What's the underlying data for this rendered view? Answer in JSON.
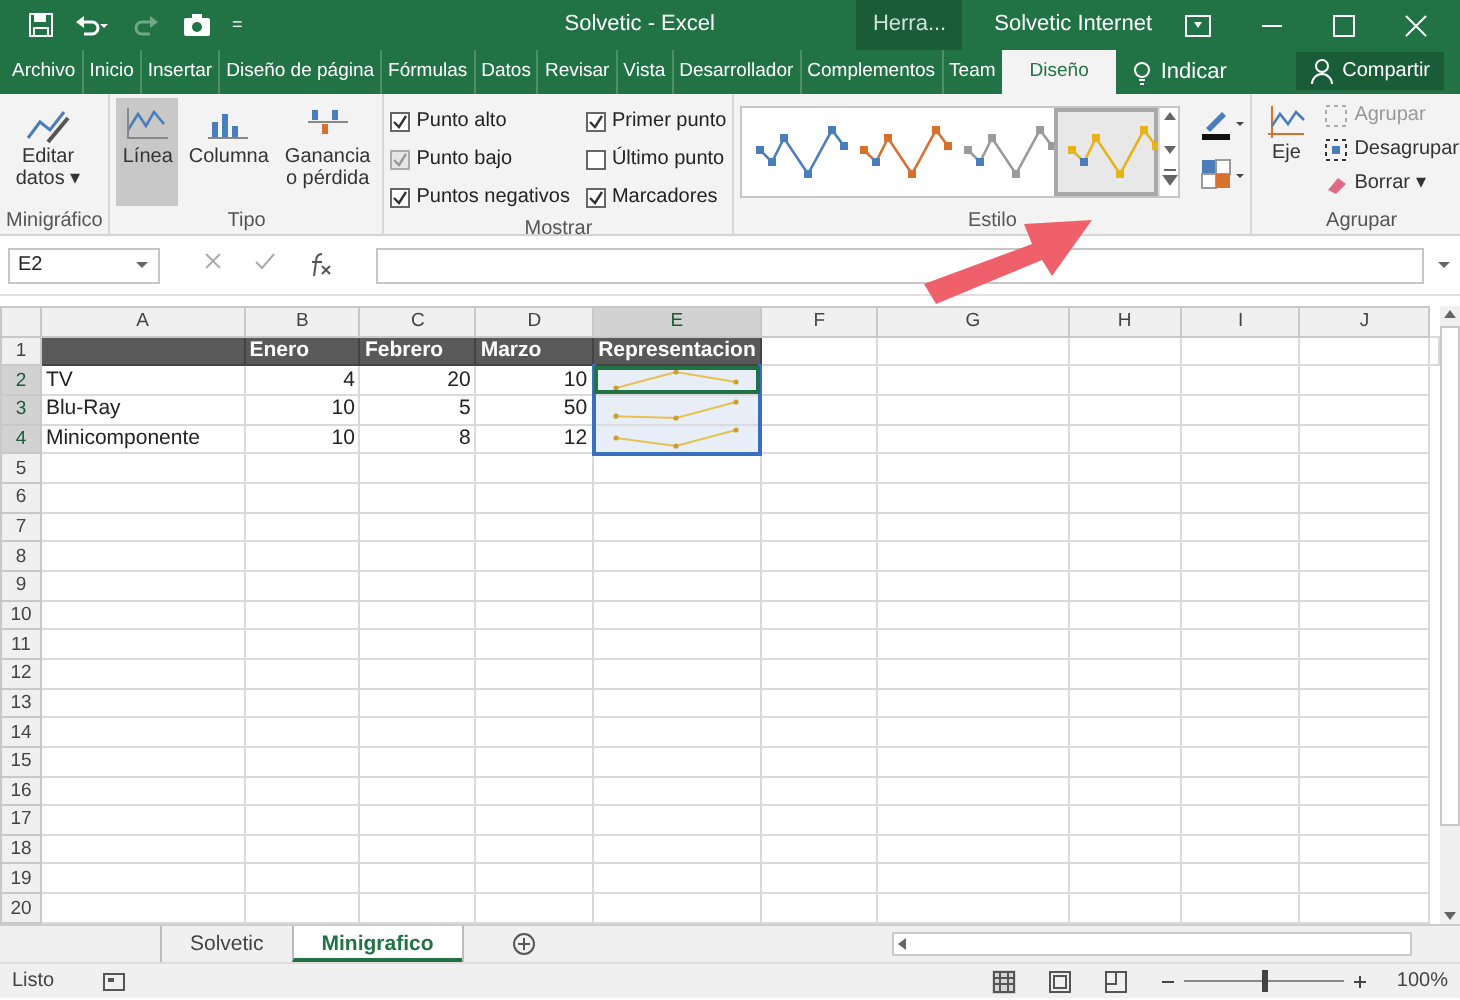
{
  "window": {
    "title": "Solvetic  -  Excel",
    "context_label": "Herra...",
    "user": "Solvetic Internet"
  },
  "quick_access": {
    "more": "="
  },
  "tabs": [
    {
      "label": "Archivo",
      "selected": false
    },
    {
      "label": "Inicio",
      "selected": false
    },
    {
      "label": "Insertar",
      "selected": false
    },
    {
      "label": "Diseño de página",
      "selected": false
    },
    {
      "label": "Fórmulas",
      "selected": false
    },
    {
      "label": "Datos",
      "selected": false
    },
    {
      "label": "Revisar",
      "selected": false
    },
    {
      "label": "Vista",
      "selected": false
    },
    {
      "label": "Desarrollador",
      "selected": false
    },
    {
      "label": "Complementos",
      "selected": false
    },
    {
      "label": "Team",
      "selected": false
    },
    {
      "label": "Diseño",
      "selected": true
    }
  ],
  "tell_me": "Indicar",
  "share": "Compartir",
  "ribbon": {
    "minigrafico": {
      "label": "Minigráfico",
      "button": "Editar datos ▾"
    },
    "tipo": {
      "label": "Tipo",
      "items": [
        {
          "label": "Línea",
          "selected": true
        },
        {
          "label": "Columna",
          "selected": false
        },
        {
          "label": "Ganancia o pérdida",
          "selected": false
        }
      ]
    },
    "mostrar": {
      "label": "Mostrar",
      "checkboxes": [
        {
          "label": "Punto alto",
          "checked": true,
          "disabled": false
        },
        {
          "label": "Punto bajo",
          "checked": true,
          "disabled": true
        },
        {
          "label": "Puntos negativos",
          "checked": true,
          "disabled": false
        },
        {
          "label": "Primer punto",
          "checked": true,
          "disabled": false
        },
        {
          "label": "Último punto",
          "checked": false,
          "disabled": false
        },
        {
          "label": "Marcadores",
          "checked": true,
          "disabled": false
        }
      ]
    },
    "estilo": {
      "label": "Estilo",
      "styles": [
        {
          "color": "#4a7ebb",
          "selected": false
        },
        {
          "color": "#d8702e",
          "selected": false
        },
        {
          "color": "#9a9a9a",
          "selected": false
        },
        {
          "color": "#e6b416",
          "selected": true
        }
      ]
    },
    "agrupar": {
      "label": "Agrupar",
      "axis": "Eje",
      "items": [
        {
          "label": "Agrupar",
          "disabled": true,
          "kind": "group"
        },
        {
          "label": "Desagrupar",
          "disabled": false,
          "kind": "ungroup"
        },
        {
          "label": "Borrar ▾",
          "disabled": false,
          "kind": "clear"
        }
      ]
    }
  },
  "formula_bar": {
    "name_box": "E2"
  },
  "sheet": {
    "columns": [
      {
        "label": "A",
        "selected": false
      },
      {
        "label": "B",
        "selected": false
      },
      {
        "label": "C",
        "selected": false
      },
      {
        "label": "D",
        "selected": false
      },
      {
        "label": "E",
        "selected": true
      },
      {
        "label": "F",
        "selected": false
      },
      {
        "label": "G",
        "selected": false
      },
      {
        "label": "H",
        "selected": false
      },
      {
        "label": "I",
        "selected": false
      },
      {
        "label": "J",
        "selected": false
      }
    ],
    "header_row": {
      "number": "1",
      "labels": [
        "Enero",
        "Febrero",
        "Marzo",
        "Representacion"
      ]
    },
    "data_rows": [
      {
        "number": "2",
        "label": "TV",
        "values": [
          "4",
          "20",
          "10"
        ],
        "selected": true,
        "active": true
      },
      {
        "number": "3",
        "label": "Blu-Ray",
        "values": [
          "10",
          "5",
          "50"
        ],
        "selected": true,
        "active": false
      },
      {
        "number": "4",
        "label": "Minicomponente",
        "values": [
          "10",
          "8",
          "12"
        ],
        "selected": true,
        "active": false
      }
    ],
    "empty_rows": [
      "5",
      "6",
      "7",
      "8",
      "9",
      "10",
      "11",
      "12",
      "13",
      "14",
      "15",
      "16",
      "17",
      "18",
      "19",
      "20"
    ]
  },
  "sheet_tabs": [
    {
      "label": "Solvetic",
      "selected": false
    },
    {
      "label": "Minigrafico",
      "selected": true
    }
  ],
  "status_bar": {
    "text": "Listo",
    "zoom": "100%",
    "zoom_level": {
      "level": 0.5
    }
  }
}
